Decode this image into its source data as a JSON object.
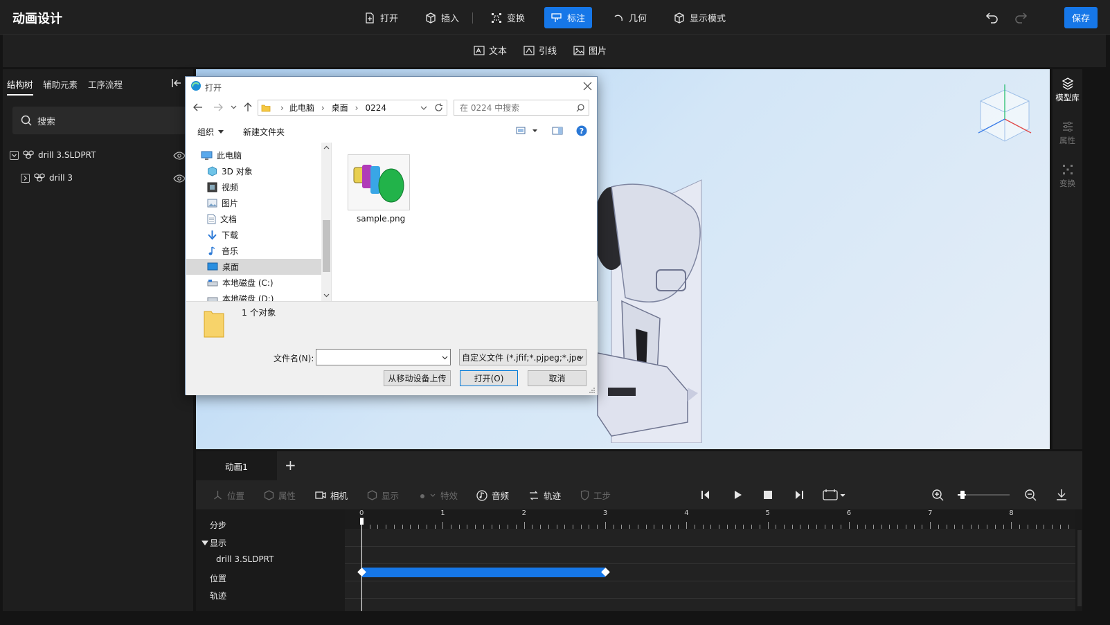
{
  "app": {
    "title": "动画设计",
    "save_label": "保存"
  },
  "toolbar": {
    "open": "打开",
    "insert": "插入",
    "transform": "变换",
    "annotate": "标注",
    "geometry": "几何",
    "display_mode": "显示模式"
  },
  "subtoolbar": {
    "text": "文本",
    "leader": "引线",
    "image": "图片"
  },
  "left_panel": {
    "tabs": [
      "结构树",
      "辅助元素",
      "工序流程"
    ],
    "search_placeholder": "搜索",
    "tree": [
      {
        "label": "drill 3.SLDPRT",
        "expanded": true
      },
      {
        "label": "drill 3",
        "expanded": false
      }
    ]
  },
  "right_rail": {
    "items": [
      "模型库",
      "属性",
      "变换"
    ]
  },
  "timeline": {
    "tab": "动画1",
    "add_tab": "+",
    "tools": {
      "position": "位置",
      "property": "属性",
      "camera": "相机",
      "display": "显示",
      "effects": "特效",
      "audio": "音频",
      "trajectory": "轨迹",
      "step": "工步"
    },
    "tracks": [
      "分步",
      "显示",
      "drill 3.SLDPRT",
      "位置",
      "轨迹"
    ],
    "ruler_ticks": [
      "0",
      "1",
      "2",
      "3",
      "4",
      "5",
      "6",
      "7",
      "8"
    ],
    "clip": {
      "track": "drill 3.SLDPRT",
      "start": 0,
      "end": 3
    }
  },
  "dialog": {
    "title": "打开",
    "breadcrumb": [
      "此电脑",
      "桌面",
      "0224"
    ],
    "search_placeholder": "在 0224 中搜索",
    "organize": "组织",
    "new_folder": "新建文件夹",
    "nav_items": [
      {
        "label": "此电脑",
        "icon": "computer-icon"
      },
      {
        "label": "3D 对象",
        "icon": "cube-icon"
      },
      {
        "label": "视频",
        "icon": "video-icon"
      },
      {
        "label": "图片",
        "icon": "image-icon"
      },
      {
        "label": "文档",
        "icon": "document-icon"
      },
      {
        "label": "下载",
        "icon": "download-icon"
      },
      {
        "label": "音乐",
        "icon": "music-icon"
      },
      {
        "label": "桌面",
        "icon": "desktop-icon",
        "selected": true
      },
      {
        "label": "本地磁盘 (C:)",
        "icon": "disk-icon"
      },
      {
        "label": "本地磁盘 (D:)",
        "icon": "disk-icon"
      }
    ],
    "files": [
      {
        "name": "sample.png"
      }
    ],
    "object_count": "1 个对象",
    "filename_label": "文件名(N):",
    "filename_value": "",
    "filetype": "自定义文件 (*.jfif;*.pjpeg;*.jpe",
    "upload_mobile": "从移动设备上传",
    "open_button": "打开(O)",
    "cancel_button": "取消"
  },
  "colors": {
    "accent": "#1677e8",
    "panel": "#1e1e1e",
    "clip": "#1677e8"
  }
}
